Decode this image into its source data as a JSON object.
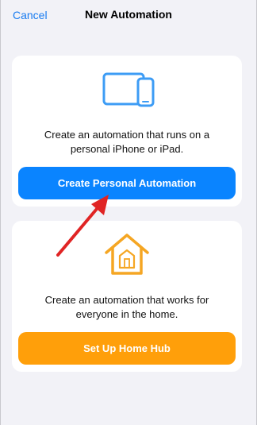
{
  "nav": {
    "cancel_label": "Cancel",
    "title": "New Automation"
  },
  "personal": {
    "icon": "devices-icon",
    "description": "Create an automation that runs on a personal iPhone or iPad.",
    "button_label": "Create Personal Automation"
  },
  "home": {
    "icon": "home-icon",
    "description": "Create an automation that works for everyone in the home.",
    "button_label": "Set Up Home Hub"
  },
  "colors": {
    "accent_blue": "#0a84ff",
    "accent_orange": "#ff9f0a",
    "annotation_red": "#e02424"
  }
}
